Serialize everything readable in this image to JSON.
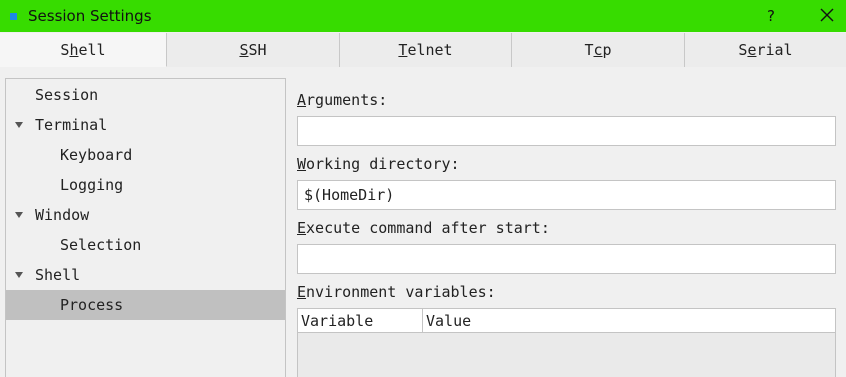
{
  "window": {
    "title": "Session Settings",
    "help_label": "?",
    "accent_color": "#37dc00"
  },
  "tabs": [
    {
      "label_pre": "S",
      "label_u": "h",
      "label_post": "ell"
    },
    {
      "label_pre": "",
      "label_u": "S",
      "label_post": "SH"
    },
    {
      "label_pre": "",
      "label_u": "T",
      "label_post": "elnet"
    },
    {
      "label_pre": "T",
      "label_u": "c",
      "label_post": "p"
    },
    {
      "label_pre": "S",
      "label_u": "e",
      "label_post": "rial"
    }
  ],
  "tree": [
    {
      "label": "Session"
    },
    {
      "label": "Terminal"
    },
    {
      "label": "Keyboard"
    },
    {
      "label": "Logging"
    },
    {
      "label": "Window"
    },
    {
      "label": "Selection"
    },
    {
      "label": "Shell"
    },
    {
      "label": "Process"
    }
  ],
  "form": {
    "arguments": {
      "label_u": "A",
      "label_rest": "rguments:",
      "value": ""
    },
    "working_dir": {
      "label_u": "W",
      "label_rest": "orking directory:",
      "value": "$(HomeDir)"
    },
    "execute": {
      "label_u": "E",
      "label_rest": "xecute command after start:",
      "value": ""
    },
    "env": {
      "label_u": "E",
      "label_rest": "nvironment variables:",
      "col_variable": "Variable",
      "col_value": "Value"
    }
  }
}
